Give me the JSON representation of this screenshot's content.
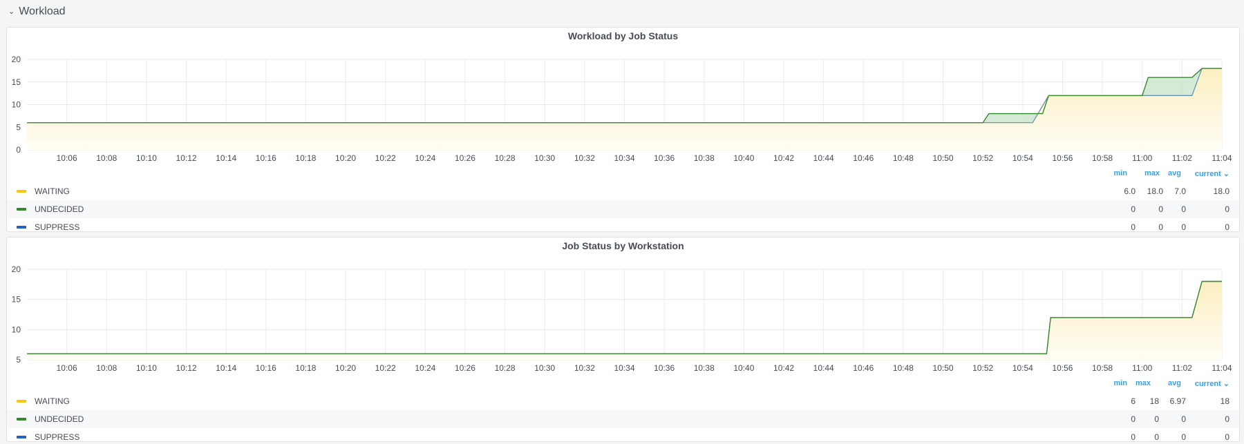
{
  "row": {
    "title": "Workload",
    "chevron_icon": "chevron-down-icon"
  },
  "colors": {
    "waiting": "#f2cc0c",
    "undecided": "#37872d",
    "waiting_fill": "#fbefc0",
    "undecided_fill": "#c9e3cc",
    "legend_header": "#33a2e5"
  },
  "panels": [
    {
      "title": "Workload by Job Status",
      "legend_headers": {
        "min": "min",
        "max": "max",
        "avg": "avg",
        "current": "current ⌄"
      },
      "legend": [
        {
          "name": "WAITING",
          "min": "6.0",
          "max": "18.0",
          "avg": "7.0",
          "current": "18.0"
        },
        {
          "name": "UNDECIDED",
          "min": "0",
          "max": "0",
          "avg": "0",
          "current": "0"
        },
        {
          "name": "SUPPRESS",
          "min": "0",
          "max": "0",
          "avg": "0",
          "current": "0"
        }
      ],
      "chart_data": {
        "type": "area",
        "x_ticks": [
          "10:06",
          "10:08",
          "10:10",
          "10:12",
          "10:14",
          "10:16",
          "10:18",
          "10:20",
          "10:22",
          "10:24",
          "10:26",
          "10:28",
          "10:30",
          "10:32",
          "10:34",
          "10:36",
          "10:38",
          "10:40",
          "10:42",
          "10:44",
          "10:46",
          "10:48",
          "10:50",
          "10:52",
          "10:54",
          "10:56",
          "10:58",
          "11:00",
          "11:02",
          "11:04"
        ],
        "y_ticks": [
          0,
          5,
          10,
          15,
          20
        ],
        "ylim": [
          0,
          20
        ],
        "series": [
          {
            "name": "WAITING",
            "color": "#f2cc0c",
            "points": [
              [
                "10:04",
                6
              ],
              [
                "10:54:5",
                6
              ],
              [
                "10:55:3",
                12
              ],
              [
                "11:02:5",
                12
              ],
              [
                "11:03:0",
                18
              ],
              [
                "11:04",
                18
              ]
            ]
          },
          {
            "name": "UNDECIDED",
            "color": "#37872d",
            "points": [
              [
                "10:04",
                6
              ],
              [
                "10:52",
                6
              ],
              [
                "10:52:3",
                8
              ],
              [
                "10:55",
                8
              ],
              [
                "10:55:3",
                12
              ],
              [
                "11:00",
                12
              ],
              [
                "11:00:3",
                16
              ],
              [
                "11:02:5",
                16
              ],
              [
                "11:03:0",
                18
              ],
              [
                "11:04",
                18
              ]
            ]
          }
        ]
      }
    },
    {
      "title": "Job Status by Workstation",
      "legend_headers": {
        "min": "min",
        "max": "max",
        "avg": "avg",
        "current": "current ⌄"
      },
      "legend": [
        {
          "name": "WAITING",
          "min": "6",
          "max": "18",
          "avg": "6.97",
          "current": "18"
        },
        {
          "name": "UNDECIDED",
          "min": "0",
          "max": "0",
          "avg": "0",
          "current": "0"
        },
        {
          "name": "SUPPRESS",
          "min": "0",
          "max": "0",
          "avg": "0",
          "current": "0"
        }
      ],
      "chart_data": {
        "type": "area",
        "x_ticks": [
          "10:06",
          "10:08",
          "10:10",
          "10:12",
          "10:14",
          "10:16",
          "10:18",
          "10:20",
          "10:22",
          "10:24",
          "10:26",
          "10:28",
          "10:30",
          "10:32",
          "10:34",
          "10:36",
          "10:38",
          "10:40",
          "10:42",
          "10:44",
          "10:46",
          "10:48",
          "10:50",
          "10:52",
          "10:54",
          "10:56",
          "10:58",
          "11:00",
          "11:02",
          "11:04"
        ],
        "y_ticks": [
          5,
          10,
          15,
          20
        ],
        "ylim": [
          5,
          20
        ],
        "series": [
          {
            "name": "WAITING",
            "color": "#f2cc0c",
            "points": [
              [
                "10:04",
                6
              ],
              [
                "10:55:2",
                6
              ],
              [
                "10:55:4",
                12
              ],
              [
                "11:02:5",
                12
              ],
              [
                "11:03:0",
                18
              ],
              [
                "11:04",
                18
              ]
            ]
          }
        ]
      }
    }
  ]
}
